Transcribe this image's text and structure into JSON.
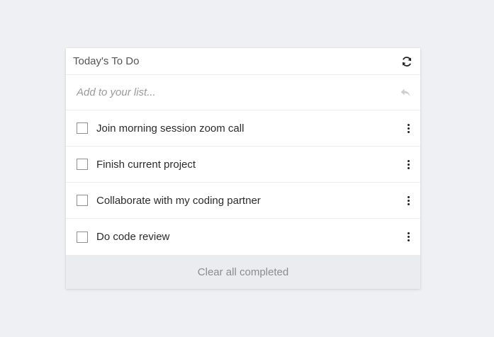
{
  "header": {
    "title": "Today's To Do",
    "refresh_icon": "refresh-icon"
  },
  "add": {
    "placeholder": "Add to your list...",
    "submit_icon": "reply-icon"
  },
  "todos": [
    {
      "text": "Join morning session zoom call",
      "checked": false
    },
    {
      "text": "Finish current project",
      "checked": false
    },
    {
      "text": "Collaborate with my coding partner",
      "checked": false
    },
    {
      "text": "Do code review",
      "checked": false
    }
  ],
  "footer": {
    "clear_label": "Clear all completed"
  },
  "colors": {
    "background": "#eff0f4",
    "card": "#ffffff",
    "footer": "#ebecf0"
  }
}
